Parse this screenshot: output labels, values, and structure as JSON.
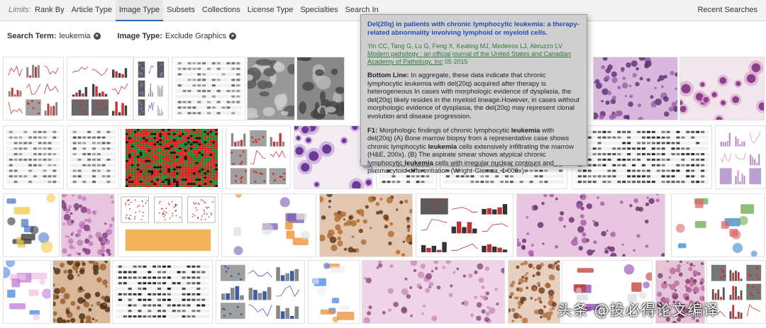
{
  "topbar": {
    "limits_label": "Limits:",
    "menu": [
      "Rank By",
      "Article Type",
      "Image Type",
      "Subsets",
      "Collections",
      "License Type",
      "Specialties",
      "Search In"
    ],
    "active_menu": "Image Type",
    "recent_searches": "Recent Searches"
  },
  "filters": {
    "search_term_label": "Search Term:",
    "search_term_value": "leukemia",
    "image_type_label": "Image Type:",
    "image_type_value": "Exclude Graphics"
  },
  "tooltip": {
    "title": "Del(20q) in patients with chronic lymphocytic leukemia: a therapy-related abnormality involving lymphoid or myeloid cells.",
    "authors": "Yin CC, Tang G, Lu G, Feng X, Keating MJ, Medeiros LJ, Abruzzo LV",
    "journal": "Modern pathology : an official journal of the United States and Canadian Academy of Pathology, Inc",
    "year": "05 2015",
    "bottom_line_label": "Bottom Line:",
    "bottom_line_text": "In aggregate, these data indicate that chronic lymphocytic leukemia with del(20q) acquired after therapy is heterogeneous In cases with morphologic evidence of dysplasia, the del(20q) likely resides in the myeloid lineage.However, in cases without morphologic evidence of dysplasia, the del(20q) may represent clonal evolution and disease progression.",
    "figure_label": "F1:",
    "figure_text_parts": [
      "Morphologic findings of chronic lymphocytic ",
      "leukemia",
      " with del(20q) (A) Bone marrow biopsy from a representative case shows chronic lymphocytic ",
      "leukemia",
      " cells extensively infiltrating the marrow (H&E, 200x). (B) The aspirate smear shows atypical chronic lymphocytic ",
      "leukemia",
      " cells with irregular nuclear contours and plasmacytoid differentiation (Wright-Giemsa, 1 000x)."
    ]
  },
  "watermark": "头条 @投必得论文编译",
  "colors": {
    "tooltip_bg": "#cfcfcf",
    "title_blue": "#1f4fb8",
    "author_green": "#2d7a3a",
    "active_tab_underline": "#2b6cb0"
  },
  "thumbnails": [
    {
      "row": 0,
      "kind": "figure-panels",
      "palette": [
        "#c33",
        "#888",
        "#f4c"
      ]
    },
    {
      "row": 0,
      "kind": "figure-panels",
      "palette": [
        "#c33",
        "#444",
        "#f9c"
      ]
    },
    {
      "row": 0,
      "kind": "figure-panels",
      "palette": [
        "#77b",
        "#333",
        "#c4c"
      ]
    },
    {
      "row": 0,
      "kind": "blots",
      "palette": [
        "#666",
        "#aaa",
        "#fff"
      ]
    },
    {
      "row": 0,
      "kind": "micrograph-gray",
      "palette": [
        "#555",
        "#999",
        "#ccc"
      ]
    },
    {
      "row": 0,
      "kind": "micrograph-gray",
      "palette": [
        "#444",
        "#888",
        "#bbb"
      ]
    },
    {
      "row": 0,
      "kind": "histology-purple",
      "palette": [
        "#9b5ea8",
        "#d8b8dc",
        "#5b2d72"
      ]
    },
    {
      "row": 0,
      "kind": "smear",
      "palette": [
        "#f2e6ee",
        "#8a3f8f",
        "#e0a5c8"
      ]
    },
    {
      "row": 1,
      "kind": "blots",
      "palette": [
        "#666",
        "#aaa",
        "#fff"
      ]
    },
    {
      "row": 1,
      "kind": "blots",
      "palette": [
        "#555",
        "#999",
        "#fff"
      ]
    },
    {
      "row": 1,
      "kind": "heatmap",
      "palette": [
        "#d22",
        "#1a8a2a",
        "#111"
      ]
    },
    {
      "row": 1,
      "kind": "figure-panels",
      "palette": [
        "#c33",
        "#888",
        "#aaa"
      ]
    },
    {
      "row": 1,
      "kind": "smear",
      "palette": [
        "#f3ecf3",
        "#6a3a9a",
        "#c7a0d8"
      ]
    },
    {
      "row": 1,
      "kind": "blots",
      "palette": [
        "#333",
        "#777",
        "#fff"
      ]
    },
    {
      "row": 1,
      "kind": "blots",
      "palette": [
        "#444",
        "#888",
        "#eee"
      ]
    },
    {
      "row": 1,
      "kind": "blots",
      "palette": [
        "#222",
        "#666",
        "#eee"
      ]
    },
    {
      "row": 1,
      "kind": "figure-panels",
      "palette": [
        "#c9b",
        "#a8c",
        "#ddd"
      ]
    },
    {
      "row": 2,
      "kind": "schematic",
      "palette": [
        "#4a7bc8",
        "#f2c94c",
        "#333"
      ]
    },
    {
      "row": 2,
      "kind": "histology-purple",
      "palette": [
        "#c27ab5",
        "#e9c4df",
        "#7a3b7a"
      ]
    },
    {
      "row": 2,
      "kind": "flow",
      "palette": [
        "#c33",
        "#f0a030",
        "#eee"
      ]
    },
    {
      "row": 2,
      "kind": "schematic",
      "palette": [
        "#f08a2a",
        "#7a5ab0",
        "#ddd"
      ]
    },
    {
      "row": 2,
      "kind": "ihc-brown",
      "palette": [
        "#b06a2a",
        "#e3c6b0",
        "#5a2f10"
      ]
    },
    {
      "row": 2,
      "kind": "figure-panels",
      "palette": [
        "#b33",
        "#333",
        "#ddd"
      ]
    },
    {
      "row": 2,
      "kind": "histology-purple",
      "palette": [
        "#a45aa5",
        "#e8c6e2",
        "#6a2b6a"
      ]
    },
    {
      "row": 2,
      "kind": "schematic",
      "palette": [
        "#6aa84f",
        "#e06666",
        "#3d85c6"
      ]
    },
    {
      "row": 3,
      "kind": "schematic",
      "palette": [
        "#c27ad8",
        "#f2c0e0",
        "#4a86e8"
      ]
    },
    {
      "row": 3,
      "kind": "ihc-brown",
      "palette": [
        "#9a5a2a",
        "#d9b89b",
        "#4a2a10"
      ]
    },
    {
      "row": 3,
      "kind": "blots",
      "palette": [
        "#111",
        "#555",
        "#ddd"
      ]
    },
    {
      "row": 3,
      "kind": "figure-panels",
      "palette": [
        "#3a5fa8",
        "#888",
        "#ddd"
      ]
    },
    {
      "row": 3,
      "kind": "schematic",
      "palette": [
        "#e69138",
        "#4a86e8",
        "#eee"
      ]
    },
    {
      "row": 3,
      "kind": "histology-purple",
      "palette": [
        "#c98bb8",
        "#eed4e6",
        "#8a4a7a"
      ]
    },
    {
      "row": 3,
      "kind": "ihc-brown",
      "palette": [
        "#b07040",
        "#e8d0c0",
        "#6a3a1a"
      ]
    },
    {
      "row": 3,
      "kind": "schematic",
      "palette": [
        "#c0392b",
        "#8e44ad",
        "#ddd"
      ]
    },
    {
      "row": 3,
      "kind": "histology-purple",
      "palette": [
        "#b86aa0",
        "#e6c4d8",
        "#7a3a6a"
      ]
    },
    {
      "row": 3,
      "kind": "figure-panels",
      "palette": [
        "#c33",
        "#555",
        "#ddd"
      ]
    },
    {
      "row": 3,
      "kind": "smear",
      "palette": [
        "#e9d6c6",
        "#8a4a3a",
        "#c79a8a"
      ]
    }
  ]
}
